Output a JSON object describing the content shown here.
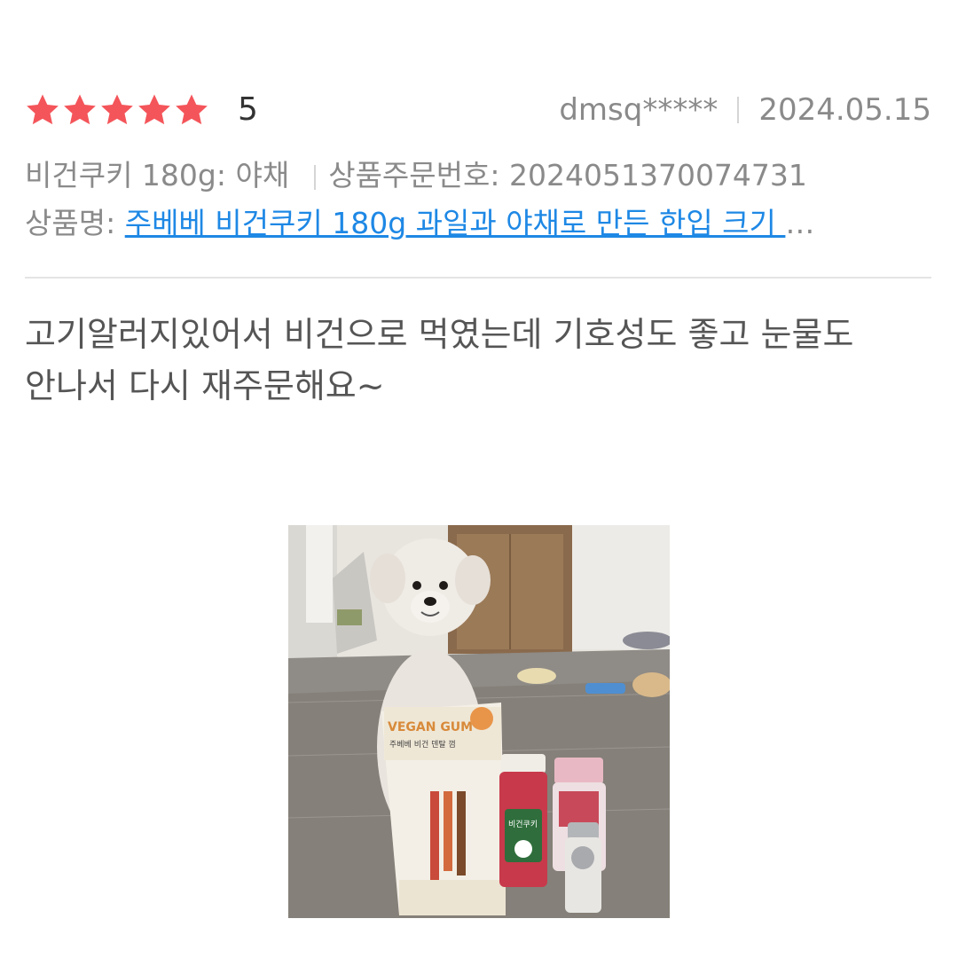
{
  "review": {
    "rating_value": "5",
    "rating_stars_filled": 5,
    "rating_stars_total": 5,
    "star_color": "#f4555a",
    "reviewer": "dmsq*****",
    "date": "2024.05.15",
    "option": "비건쿠키 180g: 야채",
    "order_label": "상품주문번호:",
    "order_number": "2024051370074731",
    "product_label": "상품명:",
    "product_name": "주베베 비건쿠키 180g 과일과 야채로 만든 한입 크기 ",
    "ellipsis": "…",
    "link_color": "#1e88e5",
    "body": "고기알러지있어서 비건으로 먹였는데 기호성도 좋고 눈물도 안나서 다시 재주문해요~"
  },
  "photo": {
    "bag_text": "VEGAN GUM",
    "bag_subtext": "주베베 비건 덴탈 껌",
    "jar_text": "비건쿠키"
  }
}
